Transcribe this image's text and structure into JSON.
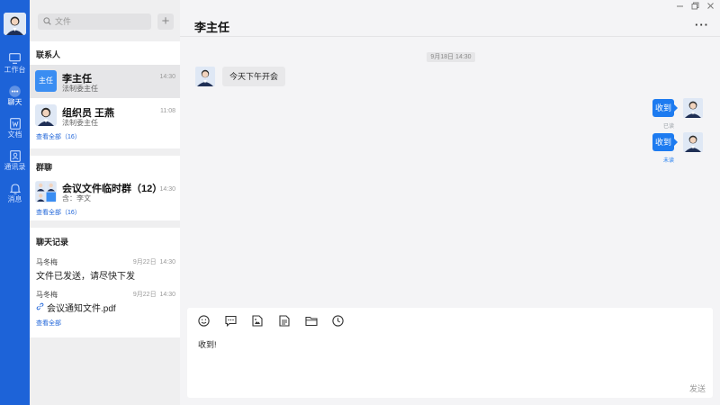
{
  "search": {
    "placeholder": "文件"
  },
  "rail": {
    "items": [
      {
        "label": "工作台",
        "icon": "monitor-icon"
      },
      {
        "label": "聊天",
        "icon": "chat-dots-icon",
        "active": true
      },
      {
        "label": "文档",
        "icon": "document-icon"
      },
      {
        "label": "通讯录",
        "icon": "contacts-icon"
      },
      {
        "label": "消息",
        "icon": "bell-icon"
      }
    ]
  },
  "contacts": {
    "title": "联系人",
    "items": [
      {
        "avatar_text": "主任",
        "name": "李主任",
        "subtitle": "法制委主任",
        "time": "14:30"
      },
      {
        "name": "组织员 王燕",
        "subtitle": "法制委主任",
        "time": "11:08"
      }
    ],
    "see_all": "查看全部（16）"
  },
  "groups": {
    "title": "群聊",
    "items": [
      {
        "name": "会议文件临时群（12）",
        "subtitle": "含：李文",
        "time": "14:30"
      }
    ],
    "see_all": "查看全部（16）"
  },
  "history": {
    "title": "聊天记录",
    "items": [
      {
        "sender": "马冬梅",
        "date": "9月22日",
        "time": "14:30",
        "text": "文件已发送，请尽快下发"
      },
      {
        "sender": "马冬梅",
        "date": "9月22日",
        "time": "14:30",
        "text": "会议通知文件.pdf"
      }
    ],
    "see_all": "查看全部"
  },
  "chat": {
    "title": "李主任",
    "menu": "···",
    "timestamp": "9月18日  14:30",
    "messages": [
      {
        "direction": "in",
        "text": "今天下午开会"
      },
      {
        "direction": "out",
        "text": "收到",
        "status": "已读"
      },
      {
        "direction": "out",
        "text": "收到",
        "status": "未读"
      }
    ]
  },
  "composer": {
    "text": "收到!",
    "send_label": "发送",
    "tools": [
      "emoji-icon",
      "quick-reply-icon",
      "image-icon",
      "file-icon",
      "folder-icon",
      "history-clock-icon"
    ]
  },
  "colors": {
    "accent": "#1d63d8",
    "bubble_out": "#1d7bf0",
    "read": "#9aa0a6",
    "unread": "#1d7bf0"
  }
}
